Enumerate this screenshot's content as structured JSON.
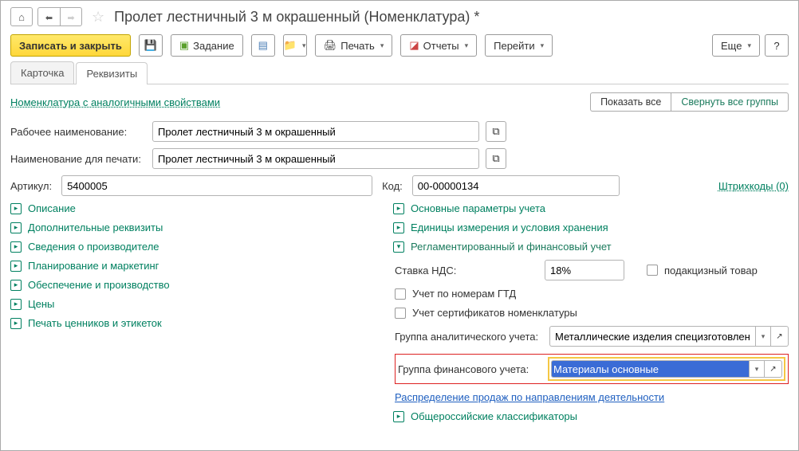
{
  "title": "Пролет лестничный 3 м окрашенный (Номенклатура) *",
  "toolbar": {
    "save_close": "Записать и закрыть",
    "task": "Задание",
    "print": "Печать",
    "reports": "Отчеты",
    "goto": "Перейти",
    "more": "Еще",
    "help": "?"
  },
  "tabs": {
    "card": "Карточка",
    "req": "Реквизиты"
  },
  "links": {
    "similar": "Номенклатура с аналогичными свойствами",
    "show_all": "Показать все",
    "collapse_all": "Свернуть все группы",
    "barcodes": "Штрихкоды (0)",
    "sales_distr": "Распределение продаж по направлениям деятельности"
  },
  "fields": {
    "work_name_label": "Рабочее наименование:",
    "work_name": "Пролет лестничный 3 м окрашенный",
    "print_name_label": "Наименование для печати:",
    "print_name": "Пролет лестничный 3 м окрашенный",
    "artikul_label": "Артикул:",
    "artikul": "5400005",
    "kod_label": "Код:",
    "kod": "00-00000134"
  },
  "groups_left": {
    "desc": "Описание",
    "addreq": "Дополнительные реквизиты",
    "maker": "Сведения о производителе",
    "plan": "Планирование и маркетинг",
    "prod": "Обеспечение и производство",
    "price": "Цены",
    "labels": "Печать ценников и этикеток"
  },
  "groups_right": {
    "params": "Основные параметры учета",
    "units": "Единицы измерения и условия хранения",
    "regfin": "Регламентированный и финансовый учет",
    "classif": "Общероссийские классификаторы"
  },
  "regfin": {
    "nds_label": "Ставка НДС:",
    "nds": "18%",
    "excise": "подакцизный товар",
    "gtd": "Учет по номерам ГТД",
    "cert": "Учет сертификатов номенклатуры",
    "analyt_label": "Группа аналитического учета:",
    "analyt": "Металлические изделия специзготовлени",
    "fin_label": "Группа финансового учета:",
    "fin": "Материалы основные"
  }
}
